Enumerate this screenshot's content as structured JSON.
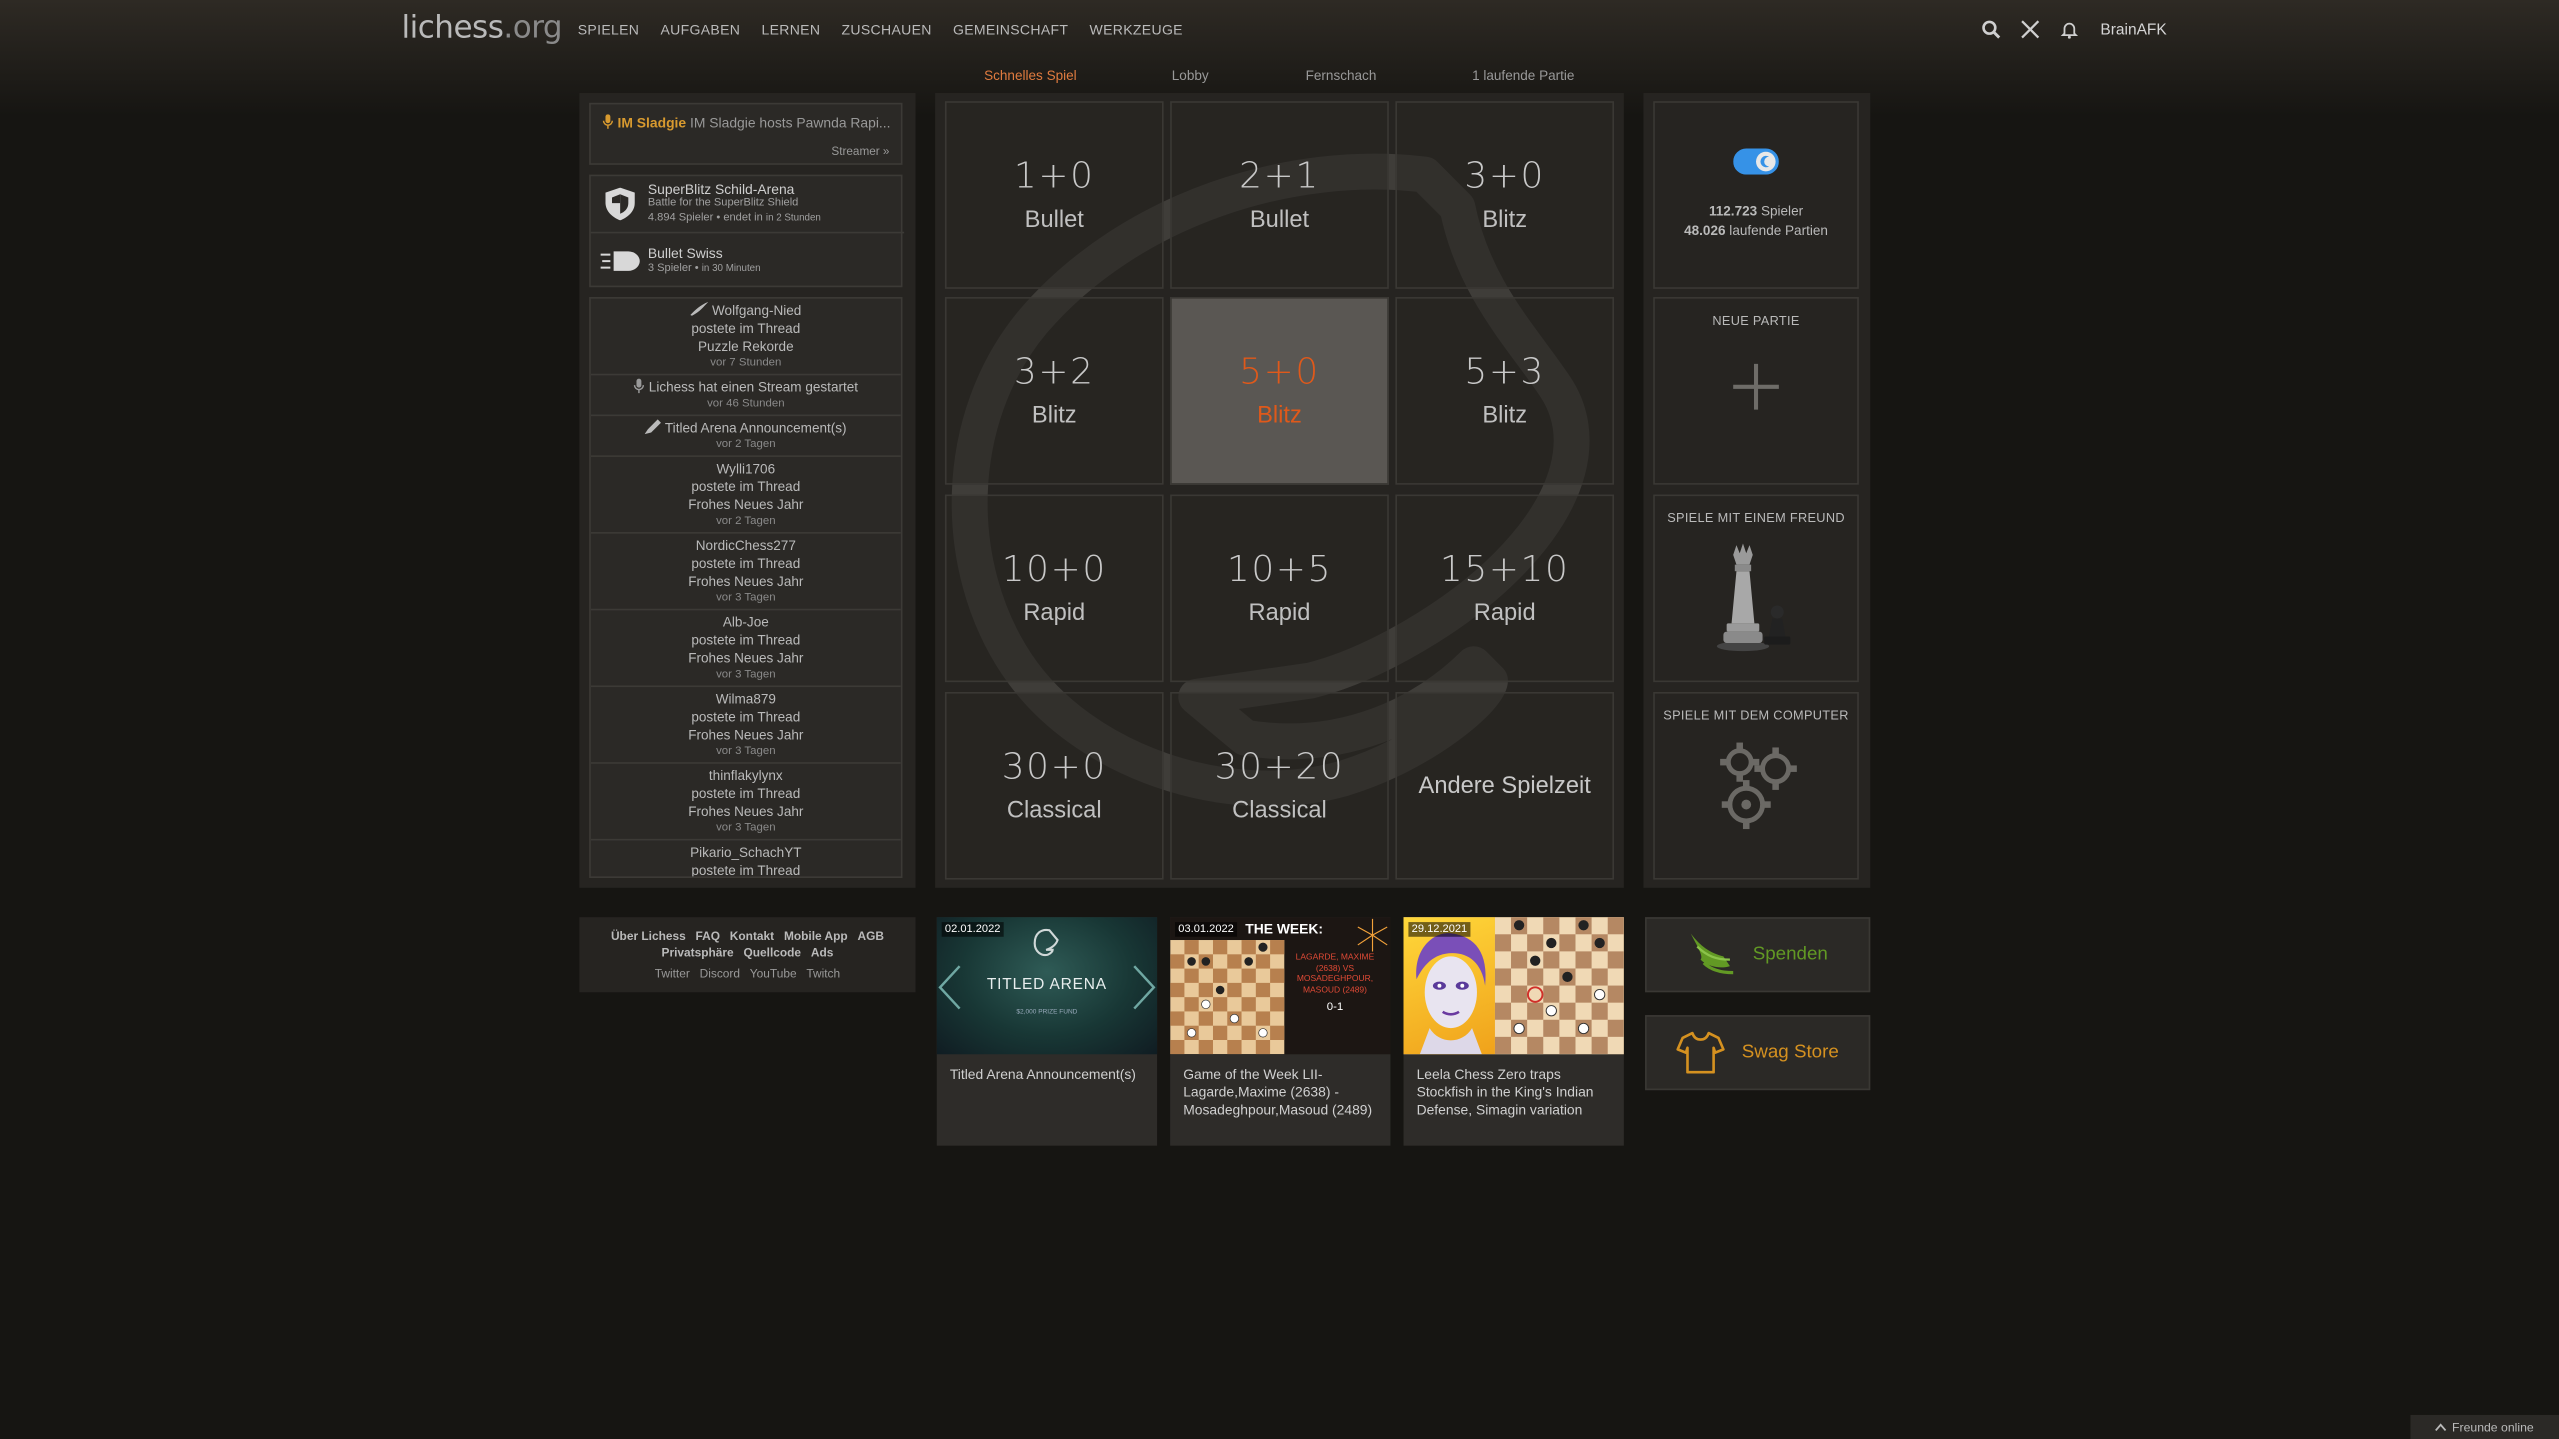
{
  "header": {
    "logo_main": "lichess",
    "logo_tld": ".org",
    "nav": [
      "SPIELEN",
      "AUFGABEN",
      "LERNEN",
      "ZUSCHAUEN",
      "GEMEINSCHAFT",
      "WERKZEUGE"
    ],
    "username": "BrainAFK"
  },
  "tabs": [
    "Schnelles Spiel",
    "Lobby",
    "Fernschach",
    "1 laufende Partie"
  ],
  "stream": {
    "streamer": "IM Sladgie",
    "text": "IM Sladgie hosts Pawnda Rapi...",
    "more": "Streamer »"
  },
  "tournaments": [
    {
      "name": "SuperBlitz Schild-Arena",
      "sub1": "Battle for the SuperBlitz Shield",
      "sub2": "4.894 Spieler • endet in",
      "sub3": "in 2 Stunden",
      "icon": "shield-icon"
    },
    {
      "name": "Bullet Swiss",
      "sub1": "3 Spieler •",
      "sub2": "in 30 Minuten",
      "icon": "bullet-icon"
    }
  ],
  "timeline": [
    {
      "lines": [
        "Wolfgang-Nied",
        "postete im Thread",
        "Puzzle Rekorde"
      ],
      "time": "vor 7 Stunden",
      "icon": "feather-icon"
    },
    {
      "lines": [
        "Lichess hat einen Stream gestartet"
      ],
      "time": "vor 46 Stunden",
      "icon": "mic-icon"
    },
    {
      "lines": [
        "Titled Arena Announcement(s)"
      ],
      "time": "vor 2 Tagen",
      "icon": "pen-icon"
    },
    {
      "lines": [
        "Wylli1706",
        "postete im Thread",
        "Frohes Neues Jahr"
      ],
      "time": "vor 2 Tagen"
    },
    {
      "lines": [
        "NordicChess277",
        "postete im Thread",
        "Frohes Neues Jahr"
      ],
      "time": "vor 3 Tagen"
    },
    {
      "lines": [
        "Alb-Joe",
        "postete im Thread",
        "Frohes Neues Jahr"
      ],
      "time": "vor 3 Tagen"
    },
    {
      "lines": [
        "Wilma879",
        "postete im Thread",
        "Frohes Neues Jahr"
      ],
      "time": "vor 3 Tagen"
    },
    {
      "lines": [
        "thinflakylynx",
        "postete im Thread",
        "Frohes Neues Jahr"
      ],
      "time": "vor 3 Tagen"
    },
    {
      "lines": [
        "Pikario_SchachYT",
        "postete im Thread"
      ],
      "time": ""
    }
  ],
  "pool": [
    {
      "time": "1+0",
      "type": "Bullet"
    },
    {
      "time": "2+1",
      "type": "Bullet"
    },
    {
      "time": "3+0",
      "type": "Blitz"
    },
    {
      "time": "3+2",
      "type": "Blitz"
    },
    {
      "time": "5+0",
      "type": "Blitz",
      "selected": true
    },
    {
      "time": "5+3",
      "type": "Blitz"
    },
    {
      "time": "10+0",
      "type": "Rapid"
    },
    {
      "time": "10+5",
      "type": "Rapid"
    },
    {
      "time": "15+10",
      "type": "Rapid"
    },
    {
      "time": "30+0",
      "type": "Classical"
    },
    {
      "time": "30+20",
      "type": "Classical"
    },
    {
      "time": "",
      "type": "Andere Spielzeit"
    }
  ],
  "stats": {
    "players_count": "112.723",
    "players_label": "Spieler",
    "games_count": "48.026",
    "games_label": "laufende Partien"
  },
  "actions": {
    "new_game": "NEUE PARTIE",
    "play_friend": "SPIELE MIT EINEM FREUND",
    "play_computer": "SPIELE MIT DEM COMPUTER"
  },
  "footer_links": {
    "row1": [
      "Über Lichess",
      "FAQ",
      "Kontakt",
      "Mobile App",
      "AGB"
    ],
    "row2": [
      "Privatsphäre",
      "Quellcode",
      "Ads"
    ],
    "row3": [
      "Twitter",
      "Discord",
      "YouTube",
      "Twitch"
    ]
  },
  "blog": [
    {
      "date": "02.01.2022",
      "title": "Titled Arena Announcement(s)",
      "img_text": "TITLED ARENA",
      "img_sub": "$2,000 PRIZE FUND"
    },
    {
      "date": "03.01.2022",
      "title": "Game of the Week LII-Lagarde,Maxime (2638) - Mosadeghpour,Masoud (2489)",
      "img_text": "THE WEEK:",
      "img_sub": "LAGARDE, MAXIME (2638) VS MOSADEGHPOUR, MASOUD (2489)",
      "img_score": "0-1"
    },
    {
      "date": "29.12.2021",
      "title": "Leela Chess Zero traps Stockfish in the King's Indian Defense, Simagin variation"
    }
  ],
  "donate": "Spenden",
  "swag": "Swag Store",
  "friends_online": "Freunde online",
  "colors": {
    "accent": "#e07b3f",
    "selected_text": "#e0591a",
    "donate_green": "#629924",
    "swag_orange": "#d59120",
    "toggle_blue": "#3692e7"
  }
}
